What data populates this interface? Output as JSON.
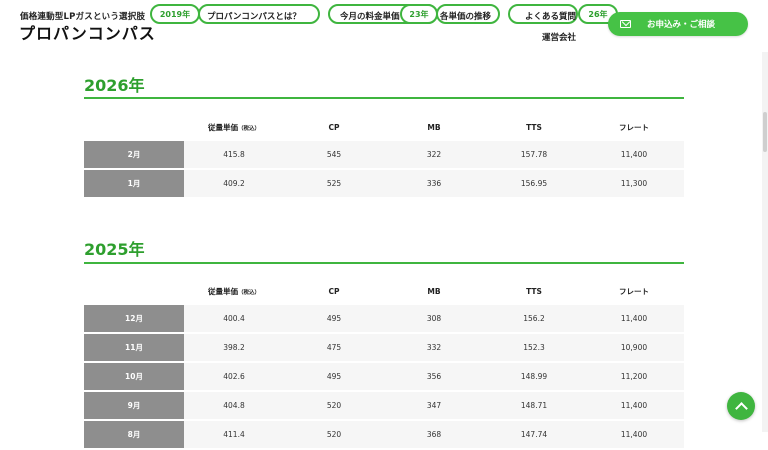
{
  "header": {
    "tagline": "価格連動型LPガスという選択肢",
    "logo": "プロパンコンパス",
    "nav": [
      {
        "label": "プロパンコンパスとは？"
      },
      {
        "label": "今月の料金単価"
      },
      {
        "label": "各単価の推移"
      },
      {
        "label": "よくある質問"
      },
      {
        "label": "運営会社"
      }
    ],
    "year_pills": [
      "2019年",
      "23年",
      "26年"
    ],
    "contact_label": "お申込み・ご相談",
    "contact_icon": "mail-icon"
  },
  "columns": {
    "unit_price": "従量単価",
    "tax_note": "（税込）",
    "cp": "CP",
    "mb": "MB",
    "tts": "TTS",
    "freight": "フレート"
  },
  "sections": [
    {
      "year": "2026年",
      "rows": [
        {
          "month": "2月",
          "price": "415.8",
          "cp": "545",
          "mb": "322",
          "tts": "157.78",
          "freight": "11,400"
        },
        {
          "month": "1月",
          "price": "409.2",
          "cp": "525",
          "mb": "336",
          "tts": "156.95",
          "freight": "11,300"
        }
      ]
    },
    {
      "year": "2025年",
      "rows": [
        {
          "month": "12月",
          "price": "400.4",
          "cp": "495",
          "mb": "308",
          "tts": "156.2",
          "freight": "11,400"
        },
        {
          "month": "11月",
          "price": "398.2",
          "cp": "475",
          "mb": "332",
          "tts": "152.3",
          "freight": "10,900"
        },
        {
          "month": "10月",
          "price": "402.6",
          "cp": "495",
          "mb": "356",
          "tts": "148.99",
          "freight": "11,200"
        },
        {
          "month": "9月",
          "price": "404.8",
          "cp": "520",
          "mb": "347",
          "tts": "148.71",
          "freight": "11,400"
        },
        {
          "month": "8月",
          "price": "411.4",
          "cp": "520",
          "mb": "368",
          "tts": "147.74",
          "freight": "11,400"
        }
      ]
    }
  ],
  "theme": {
    "accent": "#3fb53f",
    "month_cell": "#8e8e8e",
    "row_bg": "#f6f6f6"
  },
  "back_to_top_icon": "chevron-up-icon"
}
